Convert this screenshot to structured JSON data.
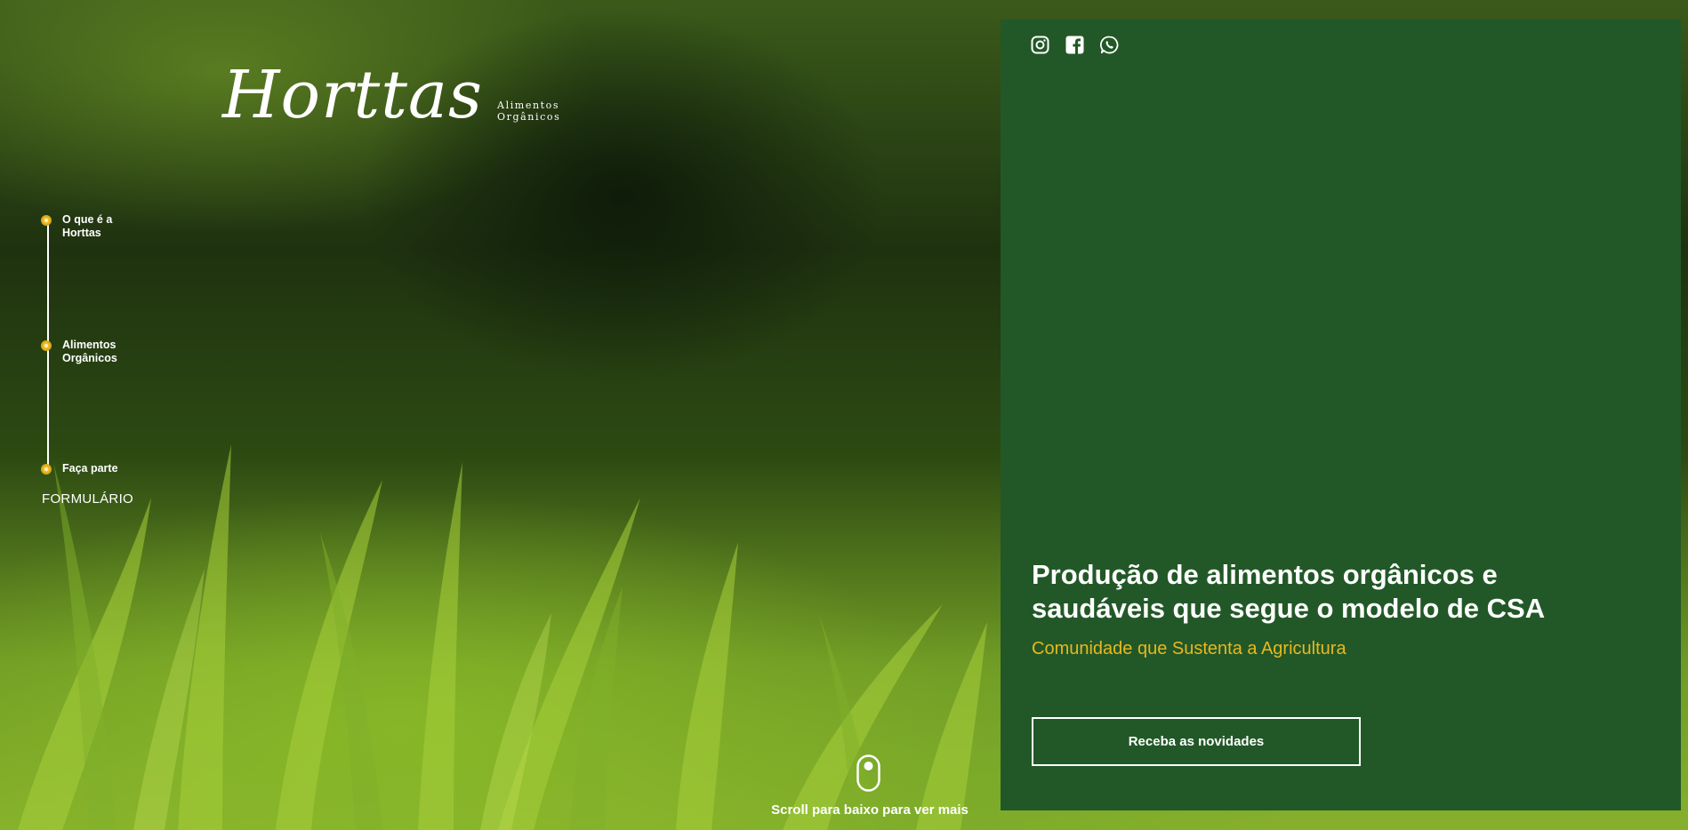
{
  "brand": {
    "name": "Horttas",
    "tagline_line1": "Alimentos",
    "tagline_line2": "Orgânicos"
  },
  "timeline": {
    "items": [
      {
        "label": "O que é a Horttas"
      },
      {
        "label": "Alimentos Orgânicos"
      },
      {
        "label": "Faça parte"
      }
    ],
    "form_link": "FORMULÁRIO"
  },
  "social": {
    "icons": [
      "instagram-icon",
      "facebook-icon",
      "whatsapp-icon"
    ]
  },
  "hero": {
    "headline": "Produção de alimentos orgânicos e saudáveis que segue o modelo de CSA",
    "subheadline": "Comunidade que Sustenta a Agricultura",
    "cta_label": "Receba as novidades"
  },
  "scroll_hint": "Scroll para baixo para ver mais",
  "colors": {
    "panel": "#225827",
    "accent": "#e8b820",
    "dot": "#f0c02a",
    "text": "#ffffff"
  }
}
